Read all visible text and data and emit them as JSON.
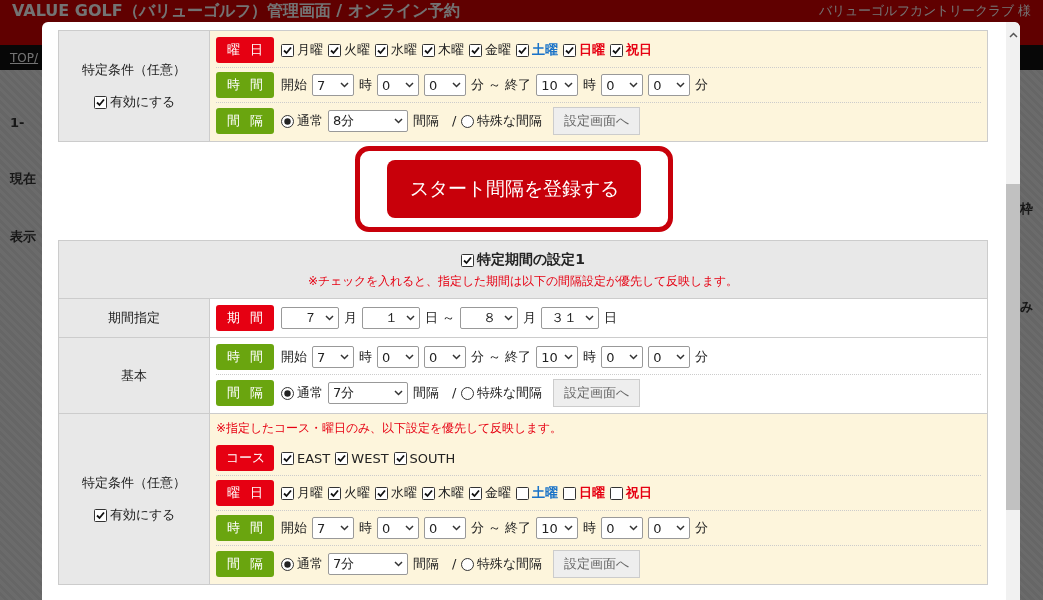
{
  "background": {
    "title": "VALUE GOLF（バリューゴルフ）管理画面 / オンライン予約",
    "user": "バリューゴルフカントリークラブ 様",
    "nav_link": "TOP/",
    "left_fragments": [
      "1-",
      "現在",
      "表示"
    ],
    "right_fragments": [
      "枠",
      "み"
    ]
  },
  "top_section": {
    "kind": "condition",
    "label": "特定条件（任意）",
    "enable": {
      "label": "有効にする",
      "checked": true
    },
    "lines": [
      {
        "tag": {
          "label": "曜日",
          "color": "#e60012"
        },
        "parts": [
          {
            "kind": "checkbox",
            "label": "月曜",
            "checked": true
          },
          {
            "kind": "checkbox",
            "label": "火曜",
            "checked": true
          },
          {
            "kind": "checkbox",
            "label": "水曜",
            "checked": true
          },
          {
            "kind": "checkbox",
            "label": "木曜",
            "checked": true
          },
          {
            "kind": "checkbox",
            "label": "金曜",
            "checked": true
          },
          {
            "kind": "checkbox",
            "label": "土曜",
            "checked": true,
            "color": "#1a73c8"
          },
          {
            "kind": "checkbox",
            "label": "日曜",
            "checked": true,
            "color": "#e60012"
          },
          {
            "kind": "checkbox",
            "label": "祝日",
            "checked": true,
            "color": "#e60012"
          }
        ]
      },
      {
        "tag": {
          "label": "時間",
          "color": "#6aa50f"
        },
        "parts": [
          {
            "kind": "text",
            "text": "開始"
          },
          {
            "kind": "select",
            "value": "7"
          },
          {
            "kind": "text",
            "text": "時"
          },
          {
            "kind": "select",
            "value": "0"
          },
          {
            "kind": "select",
            "value": "0"
          },
          {
            "kind": "text",
            "text": "分 ～ 終了"
          },
          {
            "kind": "select",
            "value": "10"
          },
          {
            "kind": "text",
            "text": "時"
          },
          {
            "kind": "select",
            "value": "0"
          },
          {
            "kind": "select",
            "value": "0"
          },
          {
            "kind": "text",
            "text": "分"
          }
        ]
      },
      {
        "tag": {
          "label": "間隔",
          "color": "#6aa50f"
        },
        "parts": [
          {
            "kind": "radio",
            "label": "通常",
            "selected": true
          },
          {
            "kind": "select_wide",
            "value": "8分"
          },
          {
            "kind": "text",
            "text": "間隔　/"
          },
          {
            "kind": "radio",
            "label": "特殊な間隔",
            "selected": false
          },
          {
            "kind": "button",
            "label": "設定画面へ"
          }
        ]
      }
    ]
  },
  "submit_button": "スタート間隔を登録する",
  "period": {
    "title": "特定期間の設定1",
    "checked": true,
    "note": "※チェックを入れると、指定した期間は以下の間隔設定が優先して反映します。",
    "sections": [
      {
        "kind": "basic",
        "label": "期間指定",
        "lines": [
          {
            "tag": {
              "label": "期間",
              "color": "#e60012"
            },
            "parts": [
              {
                "kind": "select_date",
                "value": "７"
              },
              {
                "kind": "text",
                "text": "月"
              },
              {
                "kind": "select_date",
                "value": "１"
              },
              {
                "kind": "text",
                "text": "日 ～"
              },
              {
                "kind": "select_date",
                "value": "８"
              },
              {
                "kind": "text",
                "text": "月"
              },
              {
                "kind": "select_date",
                "value": "３１"
              },
              {
                "kind": "text",
                "text": "日"
              }
            ]
          }
        ]
      },
      {
        "kind": "basic",
        "label": "基本",
        "lines": [
          {
            "tag": {
              "label": "時間",
              "color": "#6aa50f"
            },
            "parts": [
              {
                "kind": "text",
                "text": "開始"
              },
              {
                "kind": "select",
                "value": "7"
              },
              {
                "kind": "text",
                "text": "時"
              },
              {
                "kind": "select",
                "value": "0"
              },
              {
                "kind": "select",
                "value": "0"
              },
              {
                "kind": "text",
                "text": "分 ～ 終了"
              },
              {
                "kind": "select",
                "value": "10"
              },
              {
                "kind": "text",
                "text": "時"
              },
              {
                "kind": "select",
                "value": "0"
              },
              {
                "kind": "select",
                "value": "0"
              },
              {
                "kind": "text",
                "text": "分"
              }
            ]
          },
          {
            "tag": {
              "label": "間隔",
              "color": "#6aa50f"
            },
            "parts": [
              {
                "kind": "radio",
                "label": "通常",
                "selected": true
              },
              {
                "kind": "select_wide",
                "value": "7分"
              },
              {
                "kind": "text",
                "text": "間隔　/"
              },
              {
                "kind": "radio",
                "label": "特殊な間隔",
                "selected": false
              },
              {
                "kind": "button",
                "label": "設定画面へ"
              }
            ]
          }
        ]
      },
      {
        "kind": "condition",
        "label": "特定条件（任意）",
        "enable": {
          "label": "有効にする",
          "checked": true
        },
        "note": "※指定したコース・曜日のみ、以下設定を優先して反映します。",
        "lines": [
          {
            "tag": {
              "label": "コース",
              "color": "#e60012"
            },
            "parts": [
              {
                "kind": "checkbox",
                "label": "EAST",
                "checked": true
              },
              {
                "kind": "checkbox",
                "label": "WEST",
                "checked": true
              },
              {
                "kind": "checkbox",
                "label": "SOUTH",
                "checked": true
              }
            ]
          },
          {
            "tag": {
              "label": "曜日",
              "color": "#e60012"
            },
            "parts": [
              {
                "kind": "checkbox",
                "label": "月曜",
                "checked": true
              },
              {
                "kind": "checkbox",
                "label": "火曜",
                "checked": true
              },
              {
                "kind": "checkbox",
                "label": "水曜",
                "checked": true
              },
              {
                "kind": "checkbox",
                "label": "木曜",
                "checked": true
              },
              {
                "kind": "checkbox",
                "label": "金曜",
                "checked": true
              },
              {
                "kind": "checkbox",
                "label": "土曜",
                "checked": false,
                "color": "#1a73c8"
              },
              {
                "kind": "checkbox",
                "label": "日曜",
                "checked": false,
                "color": "#e60012"
              },
              {
                "kind": "checkbox",
                "label": "祝日",
                "checked": false,
                "color": "#e60012"
              }
            ]
          },
          {
            "tag": {
              "label": "時間",
              "color": "#6aa50f"
            },
            "parts": [
              {
                "kind": "text",
                "text": "開始"
              },
              {
                "kind": "select",
                "value": "7"
              },
              {
                "kind": "text",
                "text": "時"
              },
              {
                "kind": "select",
                "value": "0"
              },
              {
                "kind": "select",
                "value": "0"
              },
              {
                "kind": "text",
                "text": "分 ～ 終了"
              },
              {
                "kind": "select",
                "value": "10"
              },
              {
                "kind": "text",
                "text": "時"
              },
              {
                "kind": "select",
                "value": "0"
              },
              {
                "kind": "select",
                "value": "0"
              },
              {
                "kind": "text",
                "text": "分"
              }
            ]
          },
          {
            "tag": {
              "label": "間隔",
              "color": "#6aa50f"
            },
            "parts": [
              {
                "kind": "radio",
                "label": "通常",
                "selected": true
              },
              {
                "kind": "select_wide",
                "value": "7分"
              },
              {
                "kind": "text",
                "text": "間隔　/"
              },
              {
                "kind": "radio",
                "label": "特殊な間隔",
                "selected": false
              },
              {
                "kind": "button",
                "label": "設定画面へ"
              }
            ]
          }
        ]
      }
    ]
  }
}
